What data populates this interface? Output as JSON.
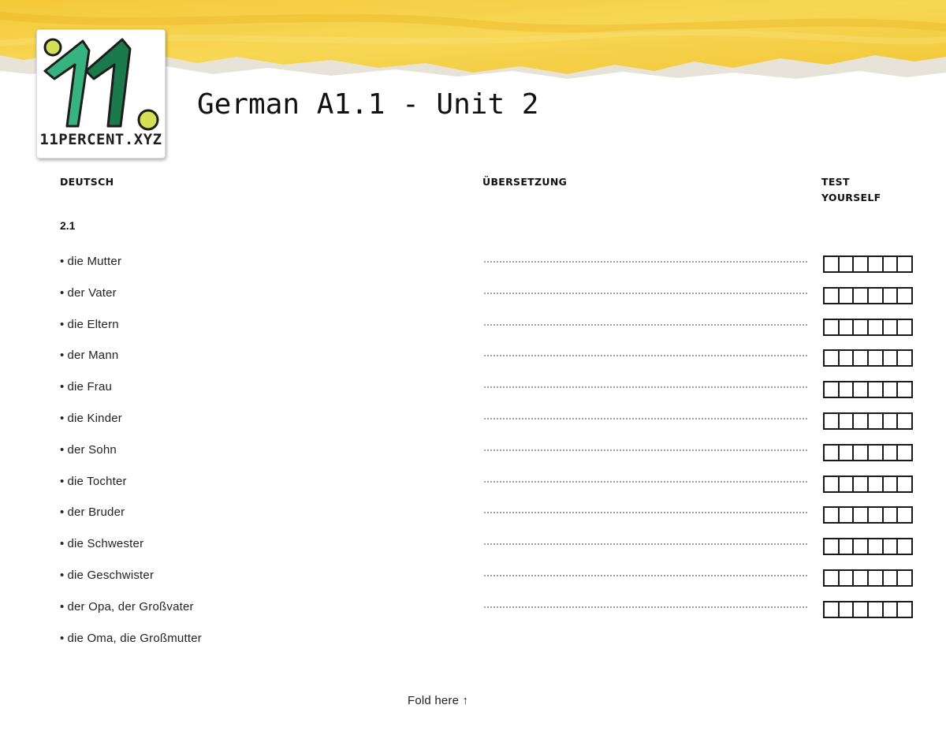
{
  "header": {
    "logo_mark": "11.",
    "logo_caption": "11PERCENT.XYZ",
    "title": "German A1.1 - Unit 2"
  },
  "columns": {
    "german": "DEUTSCH",
    "translation": "ÜBERSETZUNG",
    "test": "TEST YOURSELF"
  },
  "section": "2.1",
  "bullet": "•",
  "vocabulary": [
    {
      "term": "die Mutter",
      "has_answer_line": true,
      "test_boxes": 6
    },
    {
      "term": "der Vater",
      "has_answer_line": true,
      "test_boxes": 6
    },
    {
      "term": "die Eltern",
      "has_answer_line": true,
      "test_boxes": 6
    },
    {
      "term": "der Mann",
      "has_answer_line": true,
      "test_boxes": 6
    },
    {
      "term": "die Frau",
      "has_answer_line": true,
      "test_boxes": 6
    },
    {
      "term": "die Kinder",
      "has_answer_line": true,
      "test_boxes": 6
    },
    {
      "term": "der Sohn",
      "has_answer_line": true,
      "test_boxes": 6
    },
    {
      "term": "die Tochter",
      "has_answer_line": true,
      "test_boxes": 6
    },
    {
      "term": "der Bruder",
      "has_answer_line": true,
      "test_boxes": 6
    },
    {
      "term": "die Schwester",
      "has_answer_line": true,
      "test_boxes": 6
    },
    {
      "term": "die Geschwister",
      "has_answer_line": true,
      "test_boxes": 6
    },
    {
      "term": "der Opa, der Großvater",
      "has_answer_line": true,
      "test_boxes": 6
    },
    {
      "term": "die Oma, die Großmutter",
      "has_answer_line": false,
      "test_boxes": 0
    }
  ],
  "footer": {
    "fold_label": "Fold here ↑"
  },
  "colors": {
    "banner_yellow": "#f5cf3a",
    "logo_dark_green": "#1a7a4c",
    "logo_light_green": "#36b37e",
    "logo_lime": "#d4e157"
  }
}
